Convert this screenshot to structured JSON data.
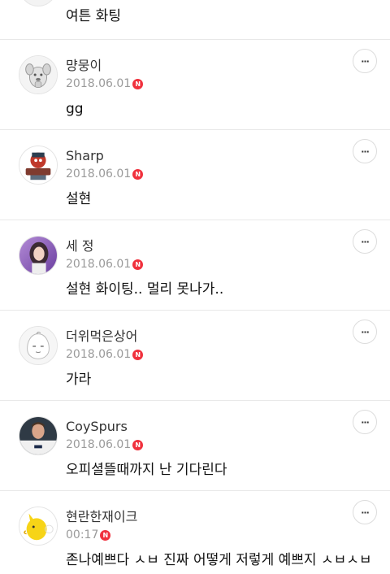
{
  "partial_comment": {
    "text": "여튼 화팅"
  },
  "comments": [
    {
      "author": "먕뭉이",
      "date": "2018.06.01",
      "new_badge": "N",
      "text": "gg",
      "avatar": "dog-character-avatar",
      "more": "···"
    },
    {
      "author": "Sharp",
      "date": "2018.06.01",
      "new_badge": "N",
      "text": "설현",
      "avatar": "sharp-logo-avatar",
      "more": "···"
    },
    {
      "author": "세 정",
      "date": "2018.06.01",
      "new_badge": "N",
      "text": "설현 화이팅.. 멀리 못나가..",
      "avatar": "woman-photo-avatar",
      "more": "···"
    },
    {
      "author": "더위먹은상어",
      "date": "2018.06.01",
      "new_badge": "N",
      "text": "가라",
      "avatar": "egg-character-avatar",
      "more": "···"
    },
    {
      "author": "CoySpurs",
      "date": "2018.06.01",
      "new_badge": "N",
      "text": "오피셜뜰때까지 난 기다린다",
      "avatar": "football-player-avatar",
      "more": "···"
    },
    {
      "author": "현란한재이크",
      "date": "00:17",
      "new_badge": "N",
      "text": "존나예쁘다 ㅅㅂ 진짜 어떻게 저렇게 예쁘지 ㅅㅂㅅㅂ",
      "avatar": "yellow-duck-avatar",
      "more": "···"
    }
  ],
  "colors": {
    "badge": "#f0313d",
    "date": "#9a9a9a",
    "divider": "#e8e8e8"
  }
}
